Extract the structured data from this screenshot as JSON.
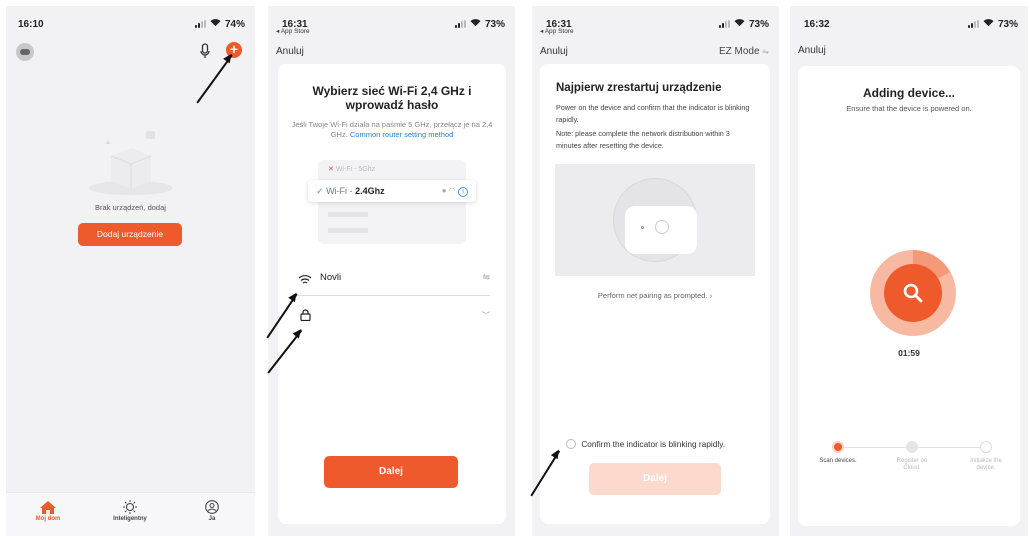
{
  "screen1": {
    "time": "16:10",
    "battery": "74%",
    "empty_text": "Brak urządzeń, dodaj",
    "add_button": "Dodaj urządzenie",
    "tabs": [
      {
        "label": "Mój dom",
        "icon": "home-icon"
      },
      {
        "label": "Inteligentny",
        "icon": "sun-icon"
      },
      {
        "label": "Ja",
        "icon": "profile-icon"
      }
    ],
    "accent": "#ef5a2c"
  },
  "screen2": {
    "time": "16:31",
    "back_app": "◂ App Store",
    "battery": "73%",
    "cancel": "Anuluj",
    "title": "Wybierz sieć Wi-Fi 2,4 GHz i wprowadź hasło",
    "note": "Jeśli Twoje Wi-Fi działa na paśmie 5 GHz, przełącz je na 2,4 GHz.",
    "link": "Common router setting method",
    "wifi_5": "Wi-Fi - 5Ghz",
    "wifi_24_prefix": "Wi-Fi - ",
    "wifi_24_bold": "2.4Ghz",
    "network_name": "Novli",
    "password_placeholder": "",
    "next": "Dalej"
  },
  "screen3": {
    "time": "16:31",
    "back_app": "◂ App Store",
    "battery": "73%",
    "cancel": "Anuluj",
    "mode": "EZ Mode",
    "title": "Najpierw zrestartuj urządzenie",
    "desc1": "Power on the device and confirm that the indicator is blinking rapidly.",
    "desc2": "Note: please complete the network distribution within 3 minutes after resetting the device.",
    "pairing_link": "Perform net pairing as prompted. ›",
    "confirm": "Confirm the indicator is blinking rapidly.",
    "next": "Dalej"
  },
  "screen4": {
    "time": "16:32",
    "battery": "73%",
    "cancel": "Anuluj",
    "title": "Adding device...",
    "subtitle": "Ensure that the device is powered on.",
    "timer": "01:59",
    "steps": [
      {
        "label": "Scan devices."
      },
      {
        "label": "Register on Cloud."
      },
      {
        "label": "Initialize the device."
      }
    ]
  }
}
